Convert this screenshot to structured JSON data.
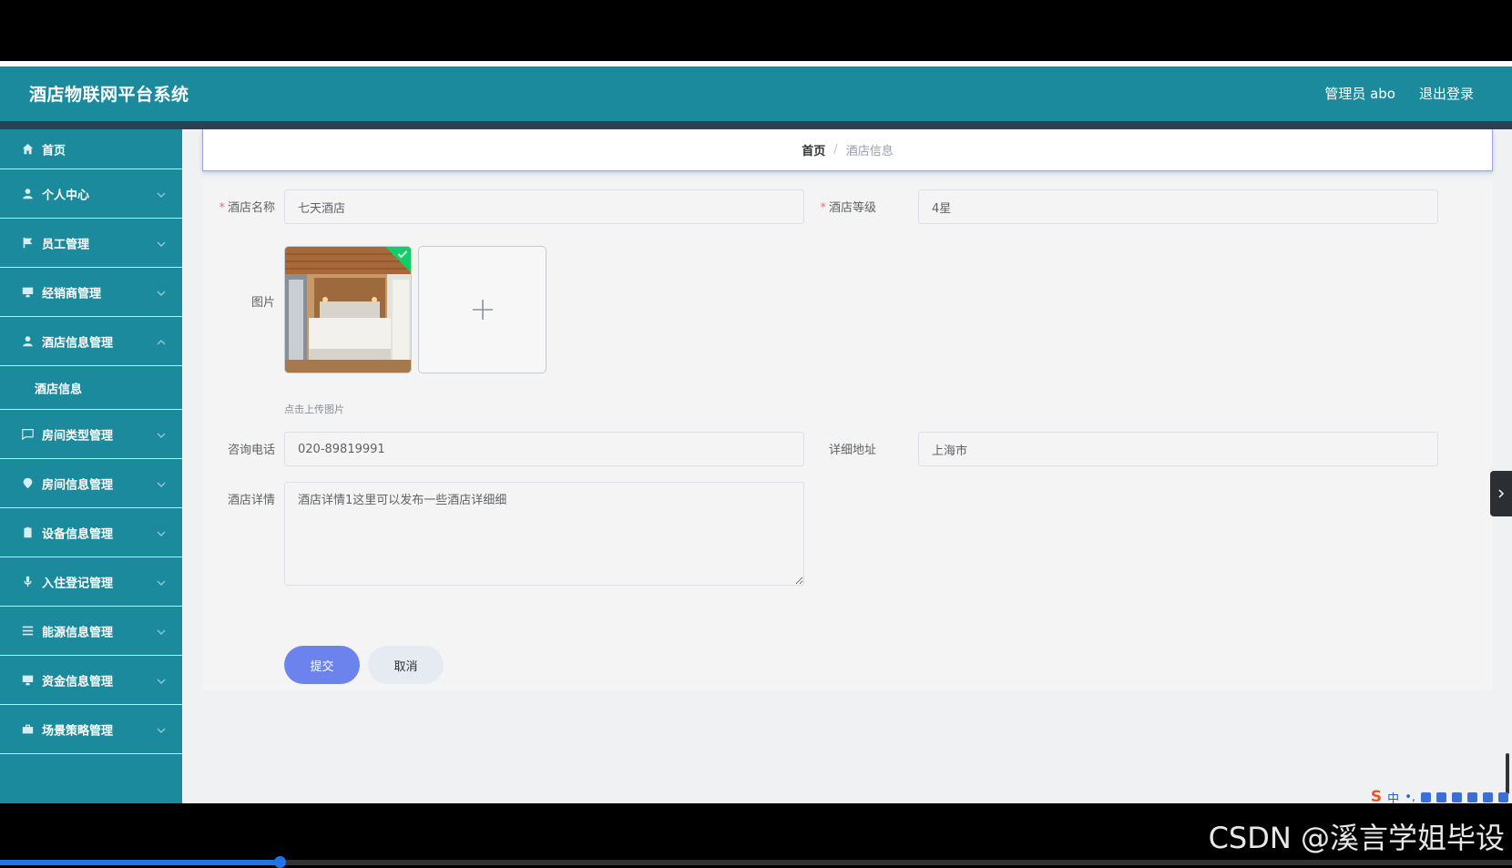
{
  "header": {
    "title": "酒店物联网平台系统",
    "user": "管理员 abo",
    "logout": "退出登录"
  },
  "sidebar": {
    "items": [
      {
        "label": "首页",
        "icon": "home-icon"
      },
      {
        "label": "个人中心",
        "icon": "user-icon"
      },
      {
        "label": "员工管理",
        "icon": "flag-icon"
      },
      {
        "label": "经销商管理",
        "icon": "monitor-icon"
      },
      {
        "label": "酒店信息管理",
        "icon": "user-icon",
        "expanded": true
      },
      {
        "label": "房间类型管理",
        "icon": "message-icon"
      },
      {
        "label": "房间信息管理",
        "icon": "location-icon"
      },
      {
        "label": "设备信息管理",
        "icon": "clipboard-icon"
      },
      {
        "label": "入住登记管理",
        "icon": "microphone-icon"
      },
      {
        "label": "能源信息管理",
        "icon": "menu-icon"
      },
      {
        "label": "资金信息管理",
        "icon": "monitor-icon"
      },
      {
        "label": "场景策略管理",
        "icon": "briefcase-icon"
      }
    ],
    "submenu": {
      "label": "酒店信息"
    }
  },
  "breadcrumb": {
    "home": "首页",
    "separator": "/",
    "current": "酒店信息"
  },
  "form": {
    "hotel_name": {
      "label": "酒店名称",
      "value": "七天酒店"
    },
    "hotel_level": {
      "label": "酒店等级",
      "value": "4星"
    },
    "image": {
      "label": "图片",
      "hint": "点击上传图片"
    },
    "phone": {
      "label": "咨询电话",
      "value": "020-89819991"
    },
    "address": {
      "label": "详细地址",
      "value": "上海市"
    },
    "detail": {
      "label": "酒店详情",
      "value": "酒店详情1这里可以发布一些酒店详细细"
    },
    "submit": "提交",
    "cancel": "取消"
  },
  "ime": {
    "lang": "中",
    "punct": "•,",
    "logo": "S"
  },
  "watermark": "CSDN @溪言学姐毕设",
  "video_progress": 0.185,
  "colors": {
    "header": "#1b8a9c",
    "submit": "#6c83ee",
    "required": "#f56c6c"
  }
}
